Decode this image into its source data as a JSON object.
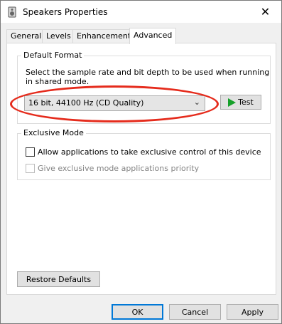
{
  "window": {
    "title": "Speakers Properties",
    "icon": "speaker-icon",
    "close_glyph": "✕"
  },
  "tabs": [
    {
      "label": "General",
      "active": false
    },
    {
      "label": "Levels",
      "active": false
    },
    {
      "label": "Enhancements",
      "active": false
    },
    {
      "label": "Advanced",
      "active": true
    }
  ],
  "default_format": {
    "title": "Default Format",
    "description": "Select the sample rate and bit depth to be used when running in shared mode.",
    "selected_value": "16 bit, 44100 Hz (CD Quality)",
    "dropdown_icon": "chevron-down-icon",
    "test_label": "Test",
    "test_icon": "play-icon",
    "highlight_color": "#e52b1c"
  },
  "exclusive_mode": {
    "title": "Exclusive Mode",
    "allow_label": "Allow applications to take exclusive control of this device",
    "allow_checked": false,
    "priority_label": "Give exclusive mode applications priority",
    "priority_checked": false,
    "priority_disabled": true
  },
  "buttons": {
    "restore_defaults": "Restore Defaults",
    "ok": "OK",
    "cancel": "Cancel",
    "apply": "Apply"
  },
  "colors": {
    "accent": "#0078d7",
    "play": "#16a02a"
  }
}
